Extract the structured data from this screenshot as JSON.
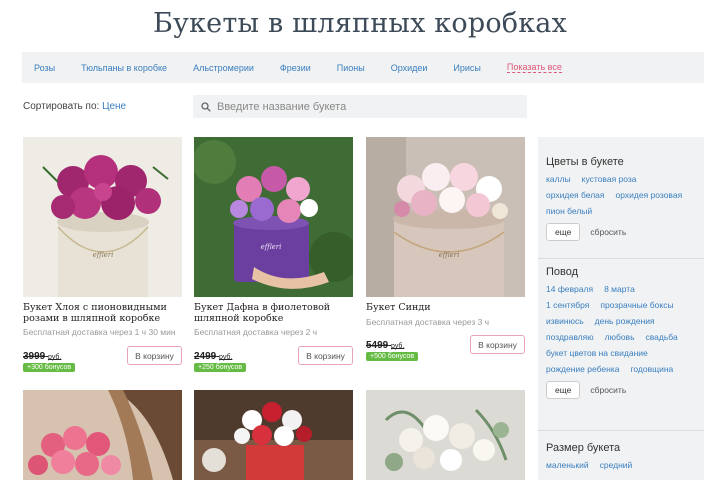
{
  "page": {
    "title": "Букеты в шляпных коробках"
  },
  "categories": [
    "Розы",
    "Тюльпаны в коробке",
    "Альстромерии",
    "Фрезии",
    "Пионы",
    "Орхидеи",
    "Ирисы",
    "Показать все"
  ],
  "sort": {
    "label": "Сортировать по:",
    "value": "Цене"
  },
  "search": {
    "placeholder": "Введите название букета"
  },
  "products": [
    {
      "name": "Букет Хлоя с пионовидными розами в шляпной коробке",
      "delivery": "Бесплатная доставка через 1 ч 30 мин",
      "price": "3999",
      "currency": "руб.",
      "bonus": "+300 бонусов",
      "cart": "В корзину"
    },
    {
      "name": "Букет Дафна в фиолетовой шляпной коробке",
      "delivery": "Бесплатная доставка через 2 ч",
      "price": "2499",
      "currency": "руб.",
      "bonus": "+250 бонусов",
      "cart": "В корзину"
    },
    {
      "name": "Букет Синди",
      "delivery": "Бесплатная доставка через 3 ч",
      "price": "5499",
      "currency": "руб.",
      "bonus": "+500 бонусов",
      "cart": "В корзину"
    }
  ],
  "filters": {
    "flowers": {
      "title": "Цветы в букете",
      "tags": [
        "каллы",
        "кустовая роза",
        "орхидея белая",
        "орхидея розовая",
        "пион белый"
      ],
      "more": "еще",
      "reset": "сбросить"
    },
    "occasion": {
      "title": "Повод",
      "tags": [
        "14 февраля",
        "8 марта",
        "1 сентября",
        "прозрачные боксы",
        "извинюсь",
        "день рождения",
        "поздравляю",
        "любовь",
        "свадьба",
        "букет цветов на свидание",
        "рождение ребенка",
        "годовщина"
      ],
      "more": "еще",
      "reset": "сбросить"
    },
    "size": {
      "title": "Размер букета",
      "tags": [
        "маленький",
        "средний"
      ]
    }
  },
  "colors": {
    "link": "#3a7fbf",
    "accent": "#e0567a",
    "bonus": "#66bb44",
    "title": "#3d4a57"
  }
}
